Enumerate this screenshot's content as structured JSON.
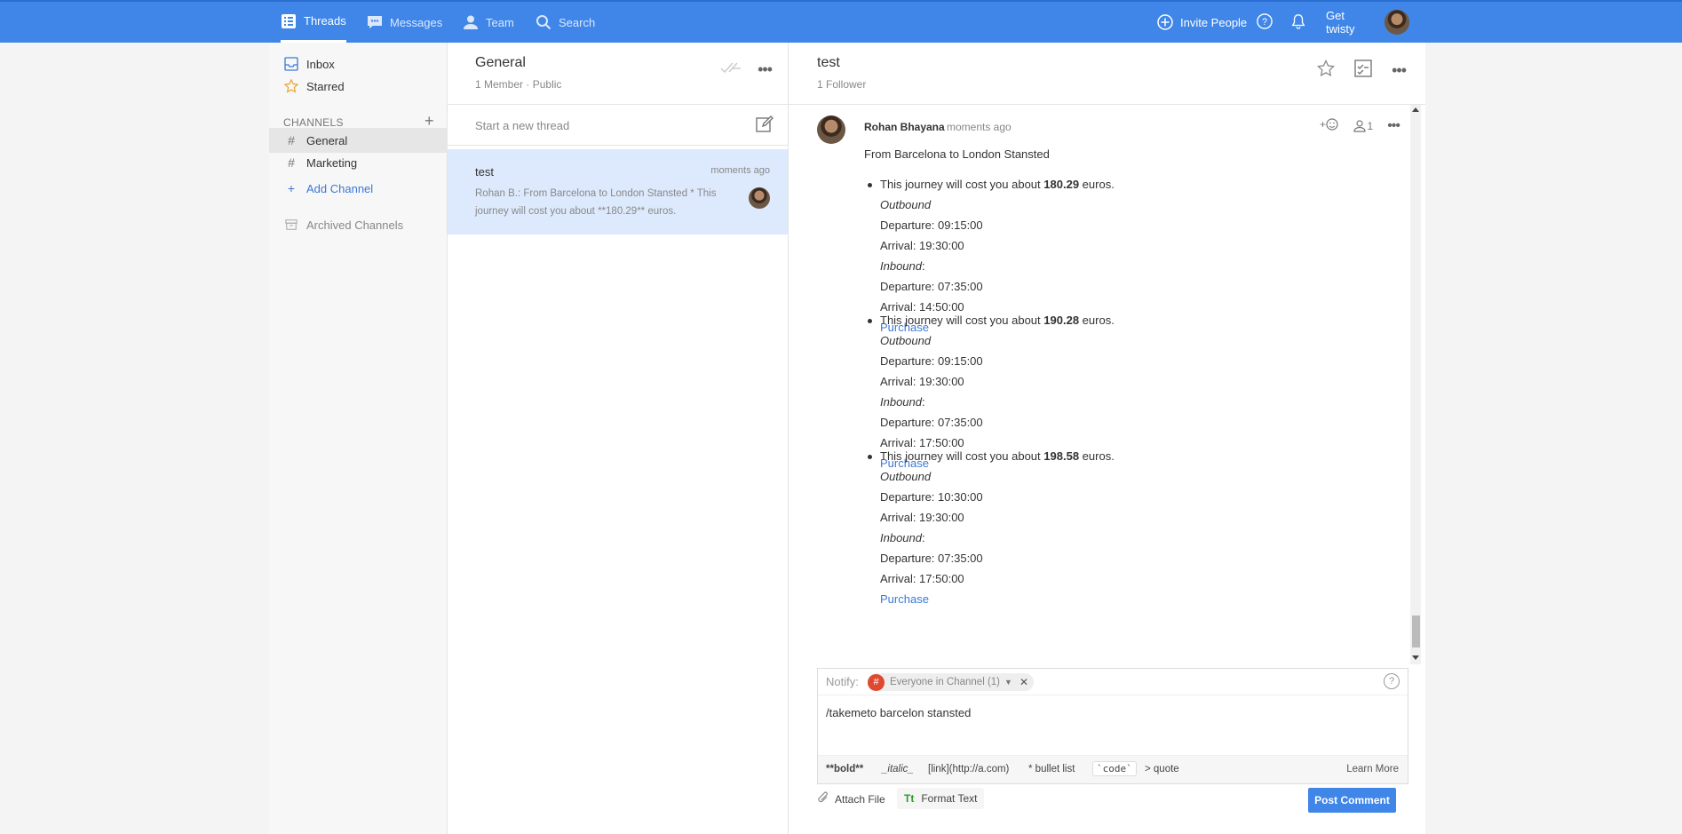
{
  "topbar": {
    "nav": [
      {
        "label": "Threads",
        "icon": "threads-icon"
      },
      {
        "label": "Messages",
        "icon": "messages-icon"
      },
      {
        "label": "Team",
        "icon": "team-icon"
      },
      {
        "label": "Search",
        "icon": "search-icon"
      }
    ],
    "invite_label": "Invite People",
    "user_label": "Get twisty",
    "brand_color": "#3f86e8"
  },
  "sidebar": {
    "inbox": "Inbox",
    "starred": "Starred",
    "channels_heading": "CHANNELS",
    "channels": [
      "General",
      "Marketing"
    ],
    "add_channel": "Add Channel",
    "archived": "Archived Channels"
  },
  "threads": {
    "title": "General",
    "members": "1 Member",
    "visibility": "Public",
    "new_thread_placeholder": "Start a new thread",
    "items": [
      {
        "title": "test",
        "time": "moments ago",
        "snippet": "Rohan B.: From Barcelona to London Stansted * This journey will cost you about **180.29** euros."
      }
    ]
  },
  "detail": {
    "title": "test",
    "followers": "1 Follower",
    "message": {
      "author": "Rohan Bhayana",
      "time": "moments ago",
      "participants": "1",
      "intro": "From Barcelona to London Stansted",
      "journeys": [
        {
          "prefix": "This journey will cost you about",
          "price": "180.29",
          "suffix": "euros.",
          "outbound_label": "Outbound",
          "out_departure": "Departure: 09:15:00",
          "out_arrival": "Arrival: 19:30:00",
          "inbound_label": "Inbound",
          "in_departure": "Departure: 07:35:00",
          "in_arrival": "Arrival: 14:50:00",
          "link": "Purchase"
        },
        {
          "prefix": "This journey will cost you about",
          "price": "190.28",
          "suffix": "euros.",
          "outbound_label": "Outbound",
          "out_departure": "Departure: 09:15:00",
          "out_arrival": "Arrival: 19:30:00",
          "inbound_label": "Inbound",
          "in_departure": "Departure: 07:35:00",
          "in_arrival": "Arrival: 17:50:00",
          "link": "Purchase"
        },
        {
          "prefix": "This journey will cost you about",
          "price": "198.58",
          "suffix": "euros.",
          "outbound_label": "Outbound",
          "out_departure": "Departure: 10:30:00",
          "out_arrival": "Arrival: 19:30:00",
          "inbound_label": "Inbound",
          "in_departure": "Departure: 07:35:00",
          "in_arrival": "Arrival: 17:50:00",
          "link": "Purchase"
        }
      ]
    }
  },
  "composer": {
    "notify_label": "Notify:",
    "notify_chip": "Everyone in Channel (1)",
    "text": "/takemeto  barcelon stansted",
    "formatting": [
      "**bold**",
      "_italic_",
      "[link](http://a.com)",
      "* bullet list",
      "`code`",
      "> quote"
    ],
    "learn_more": "Learn More",
    "attach_file": "Attach File",
    "format_text": "Format Text",
    "post_button": "Post Comment"
  }
}
